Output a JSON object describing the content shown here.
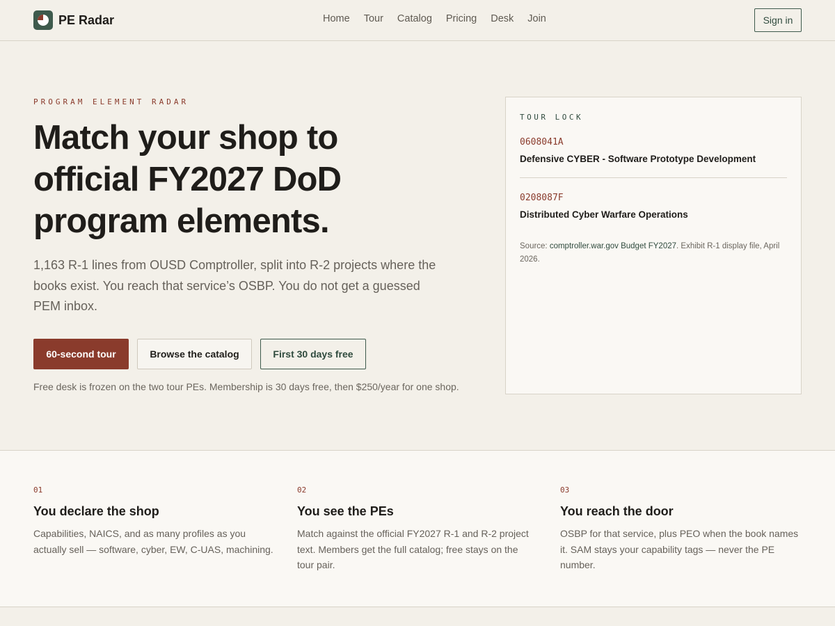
{
  "brand": {
    "name": "PE Radar",
    "logo_icon": "radar-pie-icon"
  },
  "nav": {
    "items": [
      "Home",
      "Tour",
      "Catalog",
      "Pricing",
      "Desk",
      "Join"
    ],
    "signin_label": "Sign in"
  },
  "hero": {
    "eyebrow": "PROGRAM ELEMENT RADAR",
    "title": "Match your shop to official FY2027 DoD program elements.",
    "subtitle": "1,163 R-1 lines from OUSD Comptroller, split into R-2 projects where the books exist. You reach that service’s OSBP. You do not get a guessed PEM inbox.",
    "buttons": {
      "primary": "60-second tour",
      "secondary": "Browse the catalog",
      "tertiary": "First 30 days free"
    },
    "fine_print": "Free desk is frozen on the two tour PEs. Membership is 30 days free, then $250/year for one shop."
  },
  "tour_card": {
    "label": "TOUR LOCK",
    "items": [
      {
        "code": "0608041A",
        "name": "Defensive CYBER - Software Prototype Development"
      },
      {
        "code": "0208087F",
        "name": "Distributed Cyber Warfare Operations"
      }
    ],
    "source_prefix": "Source: ",
    "source_link": "comptroller.war.gov Budget FY2027",
    "source_suffix": ". Exhibit R-1 display file, April 2026."
  },
  "steps": [
    {
      "num": "01",
      "title": "You declare the shop",
      "body": "Capabilities, NAICS, and as many profiles as you actually sell — software, cyber, EW, C-UAS, machining."
    },
    {
      "num": "02",
      "title": "You see the PEs",
      "body": "Match against the official FY2027 R-1 and R-2 project text. Members get the full catalog; free stays on the tour pair."
    },
    {
      "num": "03",
      "title": "You reach the door",
      "body": "OSBP for that service, plus PEO when the book names it. SAM stays your capability tags — never the PE number."
    }
  ],
  "colors": {
    "accent_red": "#8a3b2c",
    "accent_green": "#3e5a4c",
    "background": "#f3f0e9",
    "card": "#faf8f4"
  }
}
